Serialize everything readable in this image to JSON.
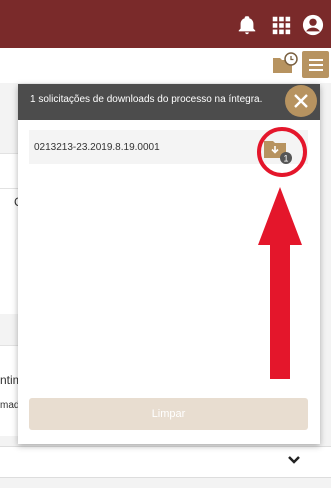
{
  "colors": {
    "header": "#7a2a2a",
    "accent": "#b79360",
    "panel_header": "#4c4c4c",
    "highlight_red": "#e4162b"
  },
  "header": {
    "icons": [
      "bell-icon",
      "apps-grid-icon",
      "account-icon"
    ]
  },
  "toolbar": {
    "icons": [
      "folder-clock-icon",
      "list-icon"
    ]
  },
  "background": {
    "partial_text_1": "C",
    "partial_text_2": "ntim",
    "partial_text_3": "mad"
  },
  "panel": {
    "title": "1 solicitações de downloads do processo na íntegra.",
    "items": [
      {
        "process_number": "0213213-23.2019.8.19.0001",
        "badge_count": "1"
      }
    ],
    "clear_label": "Limpar"
  }
}
